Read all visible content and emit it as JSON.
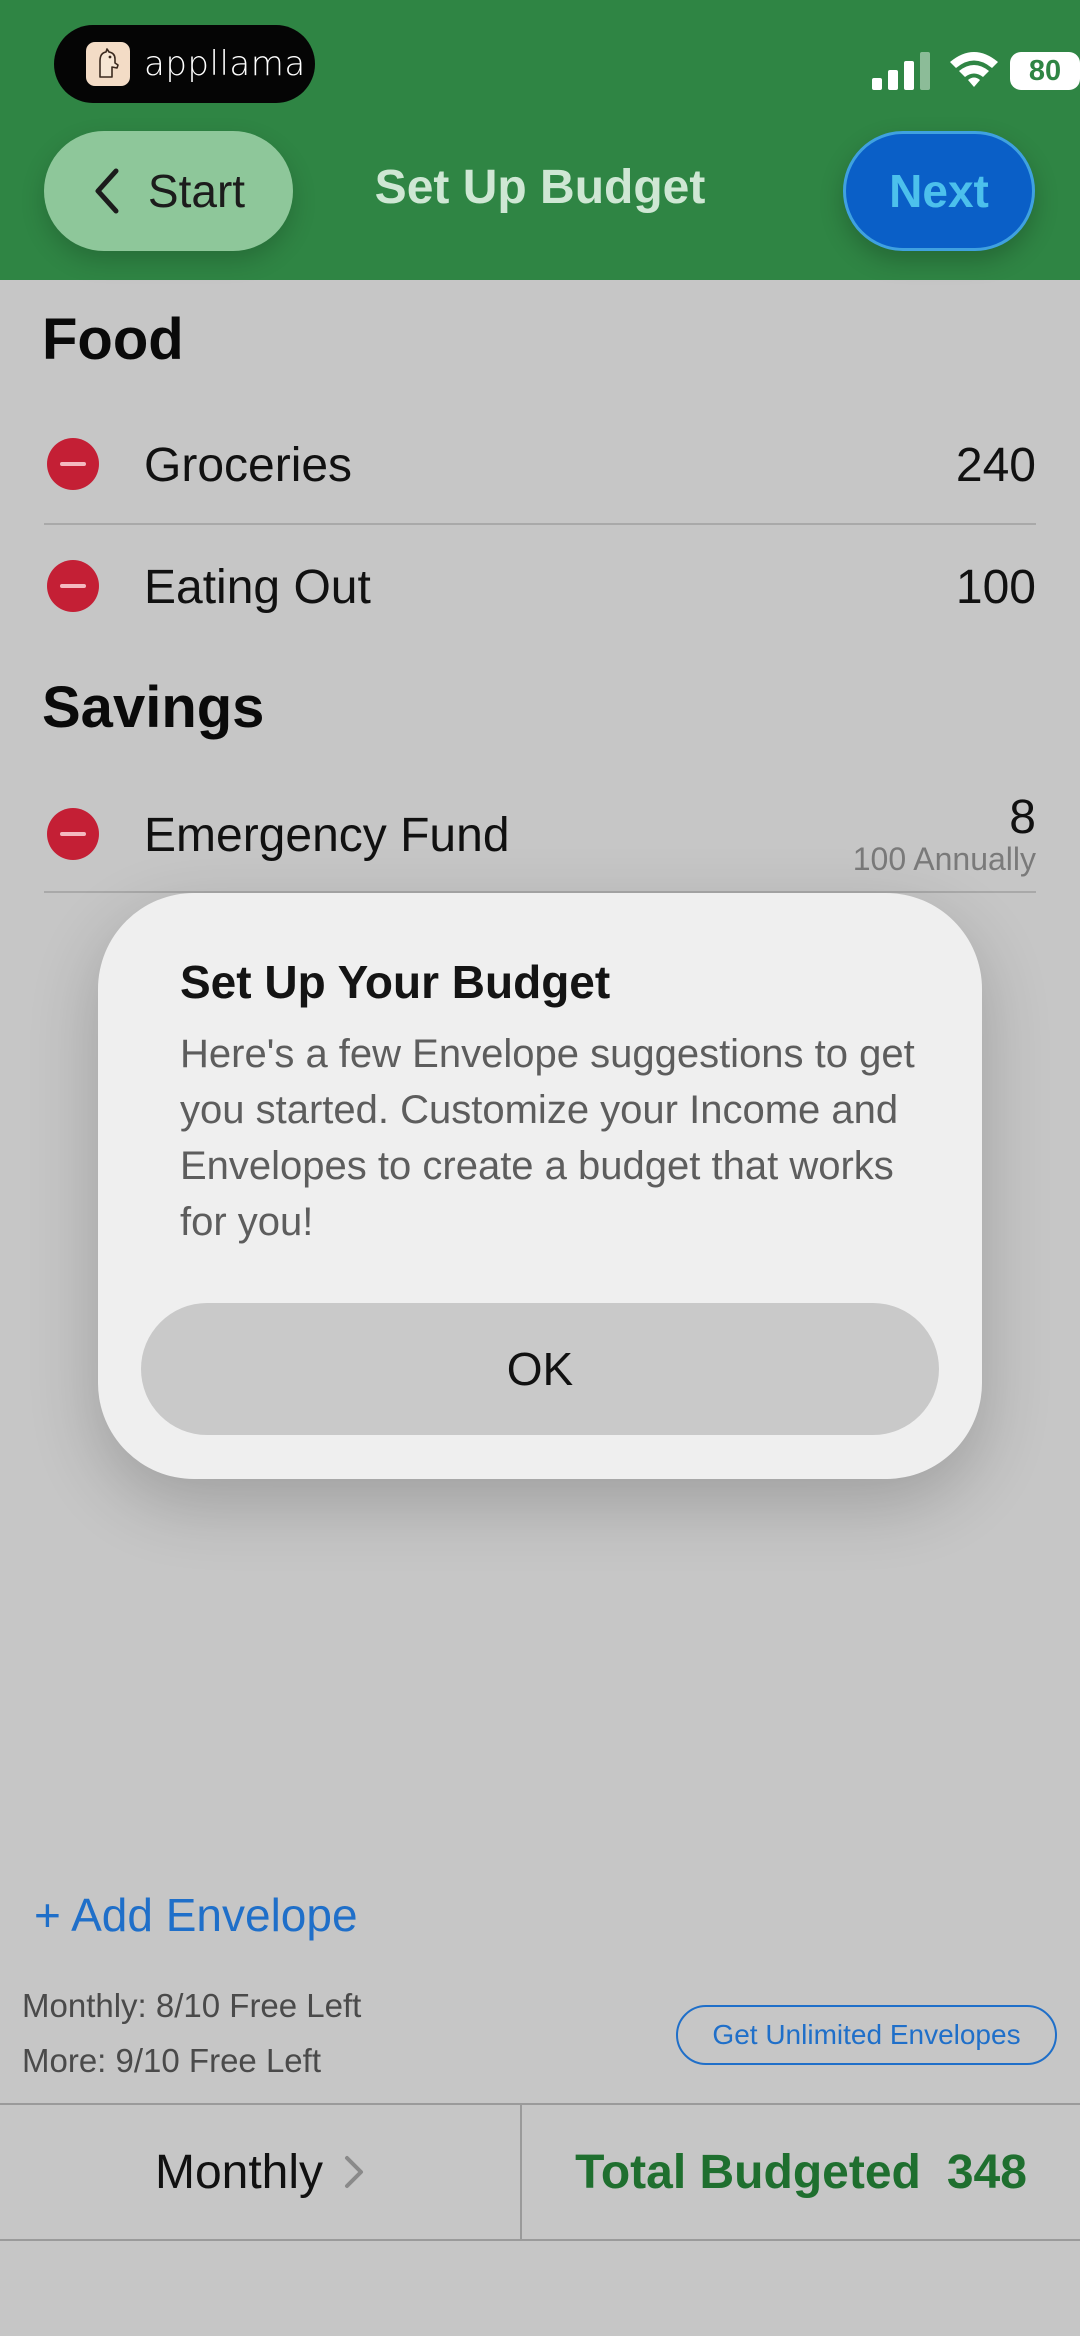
{
  "status_bar": {
    "badge_text": "appllama",
    "battery": "80",
    "icons": [
      "cellular-signal-icon",
      "wifi-icon",
      "battery-icon"
    ]
  },
  "header": {
    "back_label": "Start",
    "title": "Set Up Budget",
    "next_label": "Next",
    "colors": {
      "header_bg": "#2f8544",
      "next_bg": "#0a5fc7",
      "back_bg": "#8ec79a"
    }
  },
  "sections": [
    {
      "title": "Food",
      "items": [
        {
          "label": "Groceries",
          "value": "240"
        },
        {
          "label": "Eating Out",
          "value": "100"
        }
      ]
    },
    {
      "title": "Savings",
      "items": [
        {
          "label": "Emergency Fund",
          "value": "8",
          "sub": "100 Annually"
        }
      ]
    }
  ],
  "modal": {
    "title": "Set Up Your Budget",
    "body": "Here's a few Envelope suggestions to get you started. Customize your Income and Envelopes to create a budget that works for you!",
    "ok_label": "OK"
  },
  "footer": {
    "add_envelope": "+ Add Envelope",
    "monthly_free": "Monthly: 8/10 Free Left",
    "more_free": "More: 9/10 Free Left",
    "unlimited_label": "Get Unlimited Envelopes",
    "period": "Monthly",
    "total_label": "Total Budgeted",
    "total_value": "348",
    "colors": {
      "accent_blue": "#1f6fc9",
      "total_green": "#1f6f2f",
      "delete_red": "#c41f35"
    }
  }
}
